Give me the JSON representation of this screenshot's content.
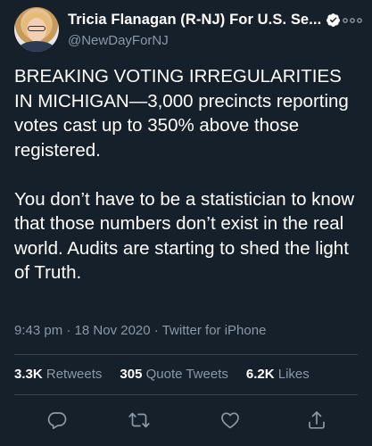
{
  "author": {
    "display_name": "Tricia Flanagan (R-NJ) For U.S. Se...",
    "handle": "@NewDayForNJ",
    "verified": true
  },
  "tweet": {
    "text": "BREAKING VOTING IRREGULARITIES IN MICHIGAN—3,000 precincts reporting votes cast up to 350% above those registered.\n\nYou don’t have to be a statistician to know that those numbers don’t exist in the real world.  Audits are starting to shed the light of Truth.",
    "time": "9:43 pm",
    "date": "18 Nov 2020",
    "source": "Twitter for iPhone"
  },
  "stats": {
    "retweets_count": "3.3K",
    "retweets_label": "Retweets",
    "quotes_count": "305",
    "quotes_label": "Quote Tweets",
    "likes_count": "6.2K",
    "likes_label": "Likes"
  },
  "icons": {
    "reply": "reply-icon",
    "retweet": "retweet-icon",
    "like": "heart-icon",
    "share": "share-icon",
    "more": "more-icon",
    "verified": "verified-badge-icon"
  },
  "colors": {
    "background": "#15202b",
    "secondary_text": "#8b98a5",
    "divider": "#38444d",
    "verified": "#ffffff"
  }
}
